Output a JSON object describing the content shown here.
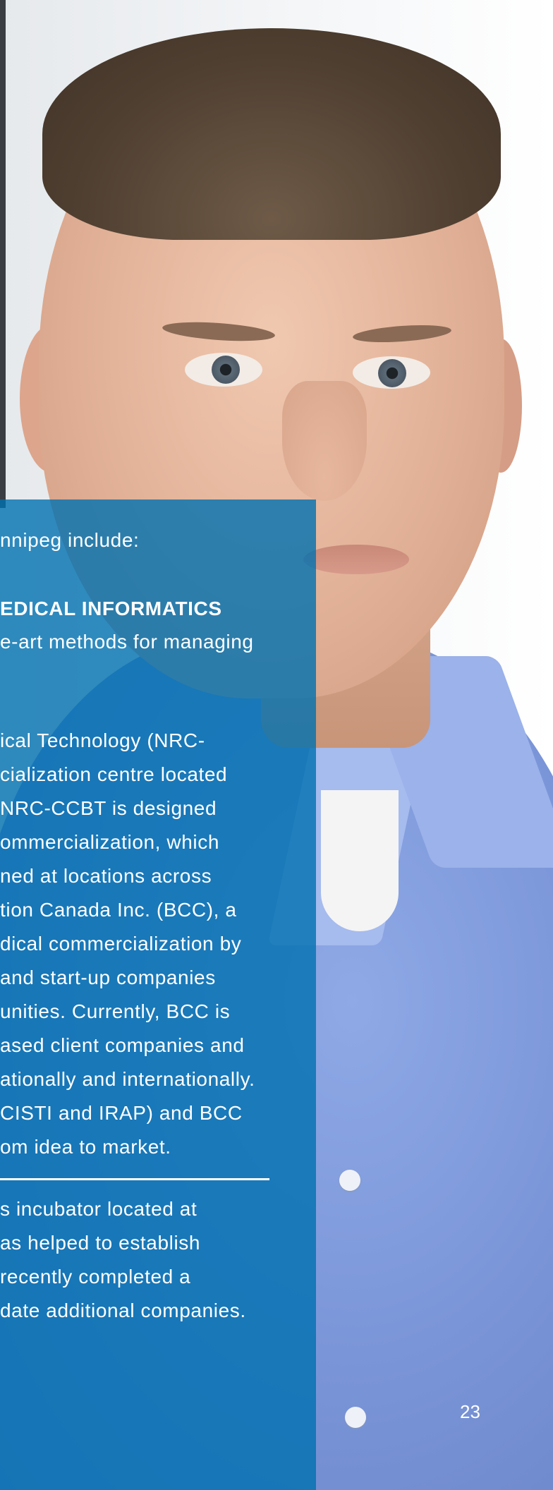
{
  "panel": {
    "intro": "nnipeg include:",
    "heading": "EDICAL INFORMATICS",
    "para1_lines": [
      "e-art methods for managing"
    ],
    "para2_lines": [
      "ical Technology (NRC-",
      "cialization centre located",
      "NRC-CCBT is designed",
      "ommercialization, which",
      "ned at locations across",
      "tion Canada Inc. (BCC), a",
      "dical commercialization by",
      " and start-up companies",
      "unities. Currently, BCC is",
      "ased client companies and",
      "ationally and internationally.",
      "CISTI and IRAP) and BCC",
      "om idea to market."
    ],
    "para3_lines": [
      "s incubator located at",
      "as helped to establish",
      " recently completed a",
      "date additional companies."
    ]
  },
  "page_number": "23",
  "colors": {
    "panel": "#0070b0",
    "text": "#ffffff"
  }
}
